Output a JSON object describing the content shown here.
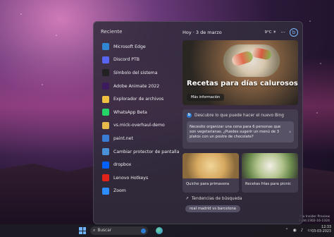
{
  "colors": {
    "accent": "#6fb3ff",
    "bing_blue": "#2b7cd3",
    "panel_bg": "#322c3c"
  },
  "recent": {
    "heading": "Reciente",
    "items": [
      {
        "label": "Microsoft Edge",
        "icon": "edge-icon",
        "color": "#2f86d1"
      },
      {
        "label": "Discord PTB",
        "icon": "discord-icon",
        "color": "#5865f2"
      },
      {
        "label": "Símbolo del sistema",
        "icon": "terminal-icon",
        "color": "#222222"
      },
      {
        "label": "Adobe Animate 2022",
        "icon": "animate-icon",
        "color": "#3b1a5e"
      },
      {
        "label": "Explorador de archivos",
        "icon": "folder-icon",
        "color": "#f0c040"
      },
      {
        "label": "WhatsApp Beta",
        "icon": "whatsapp-icon",
        "color": "#25d366"
      },
      {
        "label": "vs.mick-overhaul-demo",
        "icon": "folder-icon",
        "color": "#e8b84a"
      },
      {
        "label": "paint.net",
        "icon": "paintnet-icon",
        "color": "#3a7bd5"
      },
      {
        "label": "Cambiar protector de pantalla",
        "icon": "monitor-icon",
        "color": "#4a90d9"
      },
      {
        "label": "dropbox",
        "icon": "dropbox-icon",
        "color": "#0061fe"
      },
      {
        "label": "Lenovo Hotkeys",
        "icon": "lenovo-icon",
        "color": "#e2231a"
      },
      {
        "label": "Zoom",
        "icon": "zoom-icon",
        "color": "#2d8cff"
      }
    ]
  },
  "header": {
    "date": "Hoy · 3 de marzo",
    "temp": "9°C ☀",
    "more": "···"
  },
  "hero": {
    "title": "Recetas para días calurosos",
    "button": "Más información"
  },
  "bing": {
    "heading": "Descubre lo que puede hacer el nuevo Bing",
    "query": "Necesito organizar una cena para 6 personas que son vegetarianas. ¿Puedes sugerir un menú de 3 platos con un postre de chocolate?"
  },
  "cards": [
    {
      "caption": "Quiche para primavera"
    },
    {
      "caption": "Recetas frías para picnic"
    }
  ],
  "trends": {
    "heading": "Tendencias de búsqueda",
    "chips": [
      "real madrid vs barcelona"
    ]
  },
  "taskbar": {
    "search_placeholder": "Buscar",
    "time": "12:33",
    "date": "03-03-2023"
  },
  "watermark": {
    "line1": "Pro Insider Preview",
    "line2": "Build 2302-16-1324"
  }
}
